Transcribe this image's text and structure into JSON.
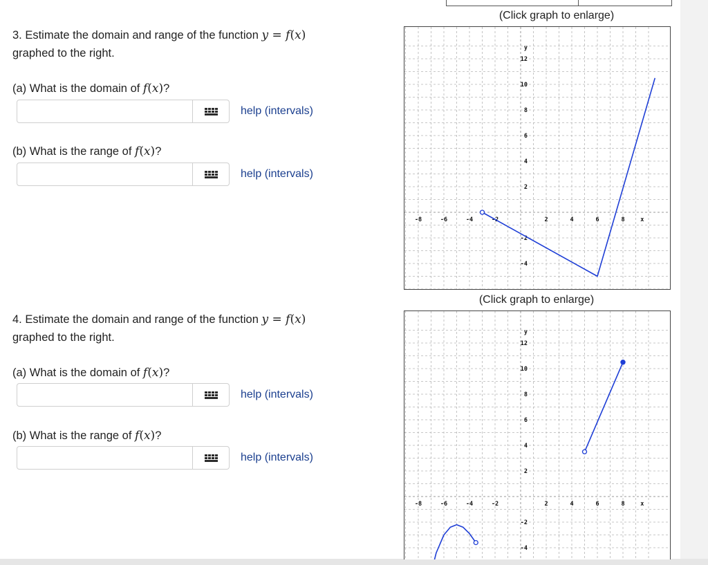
{
  "problems": [
    {
      "number_text": "3. Estimate the domain and range of the function",
      "equation": {
        "lhs": "y",
        "eq": " = ",
        "f": "f",
        "open": "(",
        "arg": "x",
        "close": ")"
      },
      "line2": "graphed to the right.",
      "parts": [
        {
          "prefix": "(a) What is the domain of",
          "f": "f",
          "open": "(",
          "arg": "x",
          "close": ")",
          "suffix": "?",
          "input_value": "",
          "help_label": "help (intervals)"
        },
        {
          "prefix": "(b) What is the range of",
          "f": "f",
          "open": "(",
          "arg": "x",
          "close": ")",
          "suffix": "?",
          "input_value": "",
          "help_label": "help (intervals)"
        }
      ],
      "enlarge_label": "(Click graph to enlarge)"
    },
    {
      "number_text": "4. Estimate the domain and range of the function",
      "equation": {
        "lhs": "y",
        "eq": " = ",
        "f": "f",
        "open": "(",
        "arg": "x",
        "close": ")"
      },
      "line2": "graphed to the right.",
      "parts": [
        {
          "prefix": "(a) What is the domain of",
          "f": "f",
          "open": "(",
          "arg": "x",
          "close": ")",
          "suffix": "?",
          "input_value": "",
          "help_label": "help (intervals)"
        },
        {
          "prefix": "(b) What is the range of",
          "f": "f",
          "open": "(",
          "arg": "x",
          "close": ")",
          "suffix": "?",
          "input_value": "",
          "help_label": "help (intervals)"
        }
      ],
      "enlarge_label": "(Click graph to enlarge)"
    }
  ],
  "chart_data": [
    {
      "type": "line",
      "xlim": [
        -9,
        10
      ],
      "ylim": [
        -6,
        13
      ],
      "grid": true,
      "x_axis_label": "x",
      "y_axis_label": "y",
      "x_ticks": [
        -8,
        -6,
        -4,
        -2,
        2,
        4,
        6,
        8
      ],
      "x_tick_labels": [
        "-8",
        "-6",
        "-4",
        "-2",
        "2",
        "4",
        "6",
        "8"
      ],
      "y_ticks": [
        12,
        10,
        8,
        6,
        4,
        2,
        -2,
        -4
      ],
      "y_tick_labels": [
        "12",
        "10",
        "8",
        "6",
        "4",
        "2",
        "-2",
        "-4"
      ],
      "color": "#1f3fd6",
      "series": [
        {
          "points": [
            [
              -3,
              0
            ],
            [
              6,
              -5
            ],
            [
              10.5,
              10.5
            ]
          ],
          "start": "open",
          "end": "none"
        }
      ]
    },
    {
      "type": "line",
      "xlim": [
        -9,
        10
      ],
      "ylim": [
        -6,
        13
      ],
      "grid": true,
      "x_axis_label": "x",
      "y_axis_label": "y",
      "x_ticks": [
        -8,
        -6,
        -4,
        -2,
        2,
        4,
        6,
        8
      ],
      "x_tick_labels": [
        "-8",
        "-6",
        "-4",
        "-2",
        "2",
        "4",
        "6",
        "8"
      ],
      "y_ticks": [
        12,
        10,
        8,
        6,
        4,
        2,
        -2,
        -4
      ],
      "y_tick_labels": [
        "12",
        "10",
        "8",
        "6",
        "4",
        "2",
        "-2",
        "-4"
      ],
      "color": "#1f3fd6",
      "series": [
        {
          "points": [
            [
              -7,
              -6
            ],
            [
              -6.6,
              -4.4
            ],
            [
              -6.0,
              -3.0
            ],
            [
              -5.5,
              -2.4
            ],
            [
              -5.0,
              -2.2
            ],
            [
              -4.5,
              -2.4
            ],
            [
              -4.0,
              -2.9
            ],
            [
              -3.5,
              -3.6
            ]
          ],
          "start": "none",
          "end": "open"
        },
        {
          "points": [
            [
              5,
              3.5
            ],
            [
              8,
              10.5
            ]
          ],
          "start": "open",
          "end": "closed"
        }
      ]
    }
  ]
}
